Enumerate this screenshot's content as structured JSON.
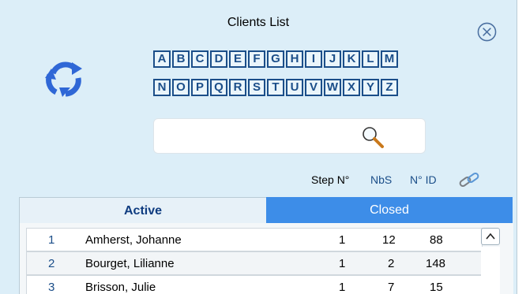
{
  "window": {
    "title": "Clients List"
  },
  "alphabet_row1": [
    "A",
    "B",
    "C",
    "D",
    "E",
    "F",
    "G",
    "H",
    "I",
    "J",
    "K",
    "L",
    "M"
  ],
  "alphabet_row2": [
    "N",
    "O",
    "P",
    "Q",
    "R",
    "S",
    "T",
    "U",
    "V",
    "W",
    "X",
    "Y",
    "Z"
  ],
  "search": {
    "value": "",
    "placeholder": ""
  },
  "columns": {
    "step": "Step N°",
    "nbs": "NbS",
    "id": "N° ID"
  },
  "tabs": {
    "active": "Active",
    "closed": "Closed",
    "selected": "Closed"
  },
  "rows": [
    {
      "n": "1",
      "name": "Amherst, Johanne",
      "step": "1",
      "nbs": "12",
      "id": "88"
    },
    {
      "n": "2",
      "name": "Bourget, Lilianne",
      "step": "1",
      "nbs": "2",
      "id": "148"
    },
    {
      "n": "3",
      "name": "Brisson, Julie",
      "step": "1",
      "nbs": "7",
      "id": "15"
    }
  ],
  "icons": {
    "close": "close-circle-icon",
    "refresh": "refresh-icon",
    "search": "magnifier-icon",
    "link": "link-icon",
    "scroll": "chevron-up-icon"
  },
  "colors": {
    "panel": "#dceef8",
    "accent": "#3d8de8",
    "letter": "#1b4e89"
  }
}
